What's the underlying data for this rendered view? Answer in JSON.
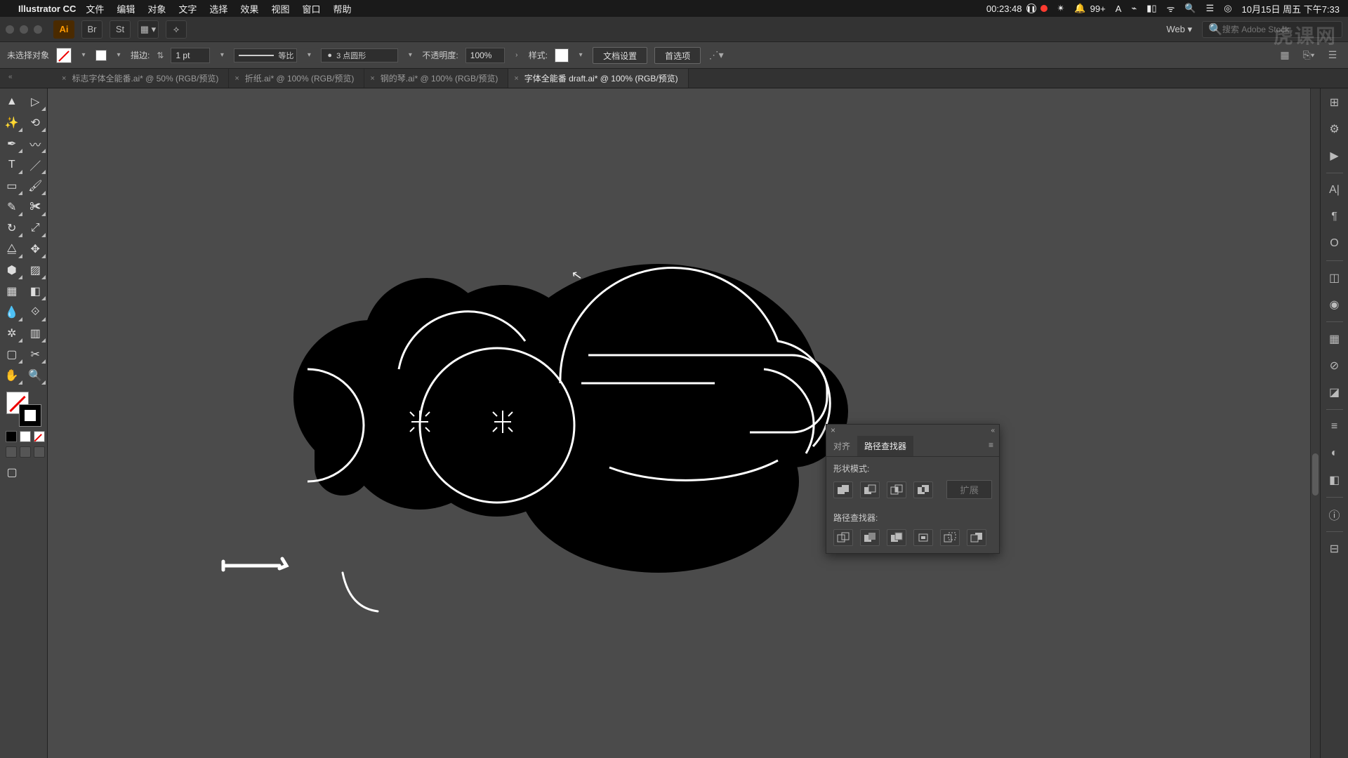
{
  "menubar": {
    "app": "Illustrator CC",
    "items": [
      "文件",
      "编辑",
      "对象",
      "文字",
      "选择",
      "效果",
      "视图",
      "窗口",
      "帮助"
    ],
    "timer": "00:23:48",
    "notif": "99+",
    "date_time": "10月15日 周五 下午7:33"
  },
  "app_top": {
    "doc_preset": "Web",
    "search_placeholder": "搜索 Adobe Stock"
  },
  "control_bar": {
    "selection": "未选择对象",
    "stroke_label": "描边:",
    "stroke_weight": "1 pt",
    "stroke_profile_label": "等比",
    "brush_label": "3 点圆形",
    "opacity_label": "不透明度:",
    "opacity_value": "100%",
    "style_label": "样式:",
    "doc_setup": "文档设置",
    "prefs": "首选项"
  },
  "tabs": [
    {
      "label": "标志字体全能番.ai* @ 50% (RGB/预览)",
      "active": false
    },
    {
      "label": "折纸.ai* @ 100% (RGB/预览)",
      "active": false
    },
    {
      "label": "钢的琴.ai* @ 100% (RGB/预览)",
      "active": false
    },
    {
      "label": "字体全能番 draft.ai* @ 100% (RGB/预览)",
      "active": true
    }
  ],
  "pathfinder": {
    "tab_align": "对齐",
    "tab_pf": "路径查找器",
    "shape_modes_label": "形状模式:",
    "pathfinders_label": "路径查找器:",
    "expand": "扩展"
  },
  "watermark": "虎课网"
}
